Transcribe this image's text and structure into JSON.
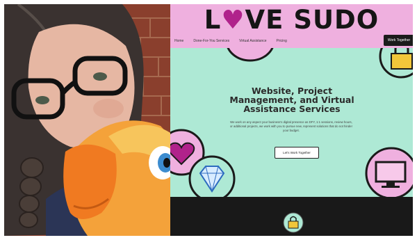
{
  "site": {
    "logo": {
      "prefix": "L",
      "heart": "♥",
      "suffix": "VE SUDO"
    },
    "nav": {
      "items": [
        "Home",
        "Done-For-You Services",
        "Virtual Assistance",
        "Pricing"
      ],
      "cta": "Work Together"
    },
    "hero": {
      "title": "Website, Project Management, and Virtual Assistance Services",
      "body": "We work on any aspect your business's digital presence as DFY, 1:1 sessions, review hours, or additional projects, we work with you to pursue new, represent solutions that do not hinder your budget.",
      "button": "Let's Work Together"
    }
  },
  "colors": {
    "header_pink": "#efb0df",
    "hero_mint": "#aee9d5",
    "footer_dark": "#191919",
    "brand_magenta": "#b0228b"
  },
  "icons": [
    "heart-icon",
    "diamond-icon",
    "lock-icon",
    "monitor-icon",
    "user-icon"
  ]
}
